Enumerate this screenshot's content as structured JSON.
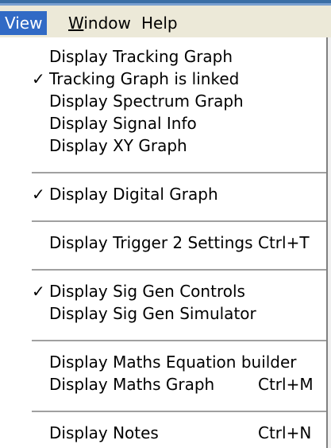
{
  "menubar": {
    "items": [
      {
        "label_pre": "",
        "label_acc": "",
        "label": "View"
      },
      {
        "label_pre": "",
        "label_acc": "W",
        "label_rest": "indow"
      },
      {
        "label": "Help"
      }
    ]
  },
  "view_menu": {
    "items": [
      {
        "label": "Display Tracking Graph",
        "checked": false
      },
      {
        "label": "Tracking Graph is linked",
        "checked": true,
        "check_glyph": "✓"
      },
      {
        "label": "Display Spectrum Graph",
        "checked": false
      },
      {
        "label": "Display Signal Info",
        "checked": false
      },
      {
        "label": "Display XY Graph",
        "checked": false
      },
      {
        "label": "Display Digital Graph",
        "checked": true,
        "check_glyph": "✓"
      },
      {
        "label": "Display Trigger 2 Settings",
        "checked": false,
        "shortcut": "Ctrl+T"
      },
      {
        "label": "Display Sig Gen Controls",
        "checked": true,
        "check_glyph": "✓"
      },
      {
        "label": "Display Sig Gen Simulator",
        "checked": false
      },
      {
        "label": "Display Maths Equation builder",
        "checked": false
      },
      {
        "label": "Display Maths Graph",
        "checked": false,
        "shortcut": "Ctrl+M"
      },
      {
        "label": "Display Notes",
        "checked": false,
        "shortcut": "Ctrl+N"
      }
    ]
  },
  "colors": {
    "menubar_bg": "#ece9d8",
    "highlight": "#316ac5",
    "separator": "#a0a0a0"
  }
}
